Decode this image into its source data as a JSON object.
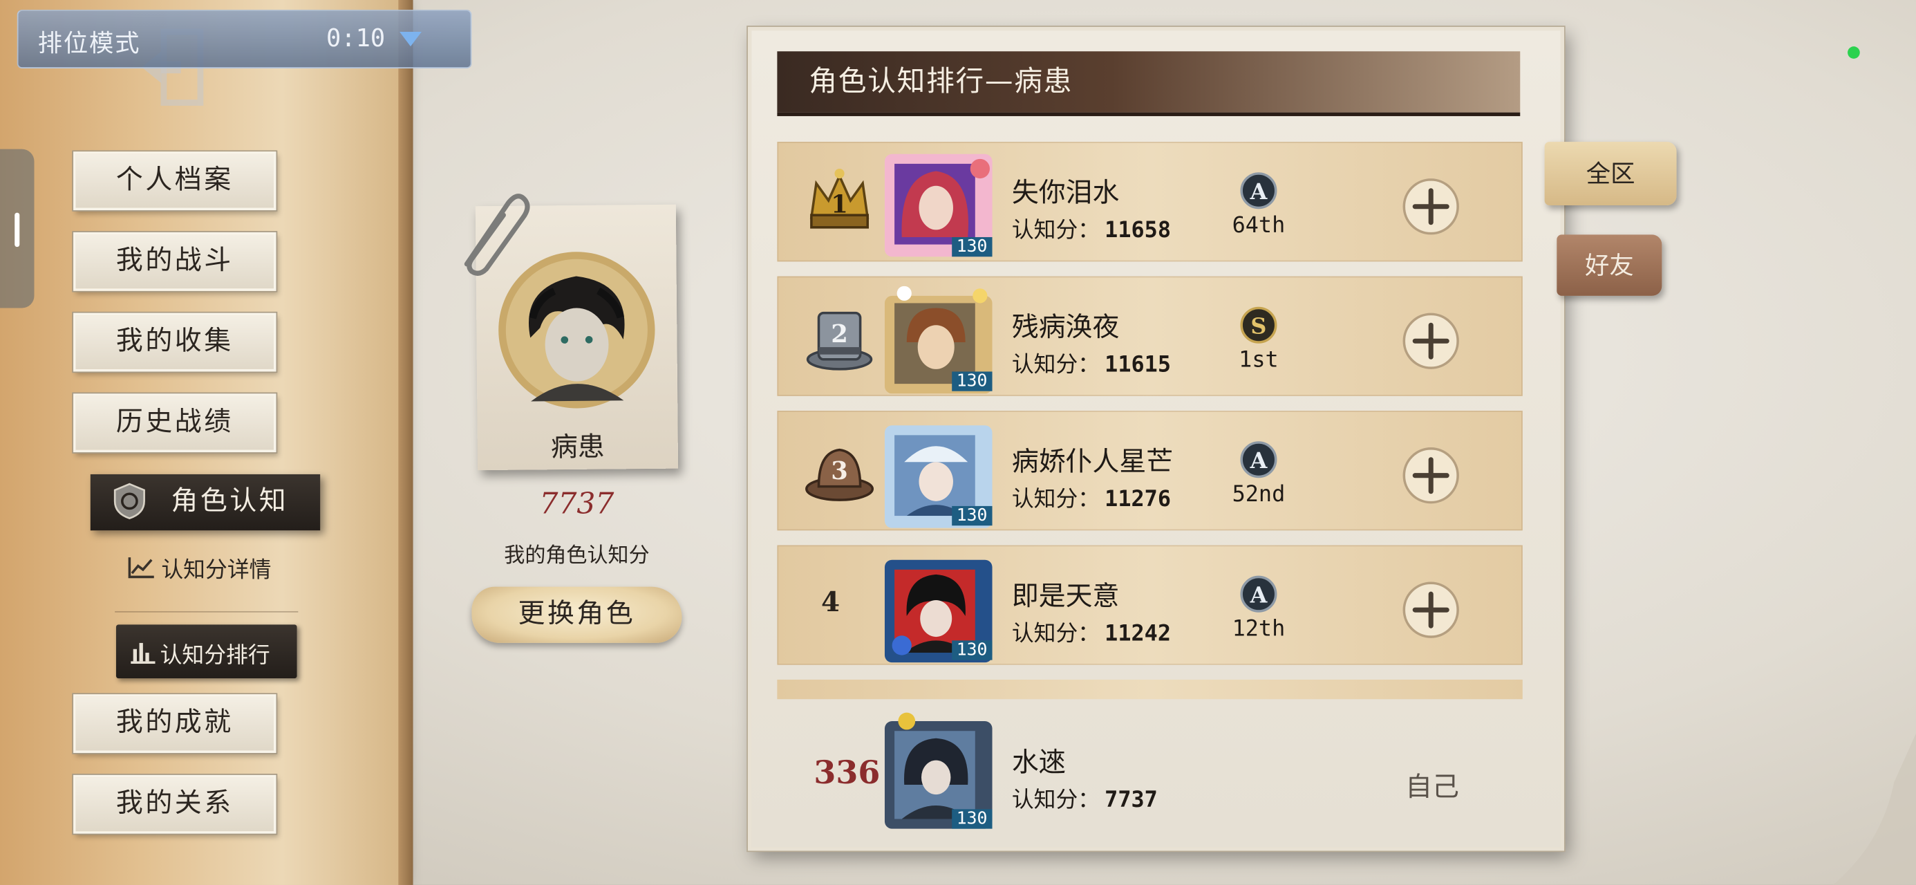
{
  "mode_bar": {
    "title": "排位模式",
    "time": "0:10"
  },
  "sidebar": {
    "items": [
      {
        "label": "个人档案"
      },
      {
        "label": "我的战斗"
      },
      {
        "label": "我的收集"
      },
      {
        "label": "历史战绩"
      },
      {
        "label": "角色认知"
      },
      {
        "label": "我的成就"
      },
      {
        "label": "我的关系"
      }
    ],
    "sub_items": [
      {
        "label": "认知分详情"
      },
      {
        "label": "认知分排行"
      }
    ]
  },
  "character": {
    "name": "病患",
    "score": "7737",
    "score_label": "我的角色认知分",
    "change_button": "更换角色"
  },
  "leaderboard": {
    "title": "角色认知排行—病患",
    "score_prefix": "认知分：",
    "rows": [
      {
        "rank": "1",
        "name": "失你泪水",
        "score": "11658",
        "tier": "A",
        "tier_rank": "64th",
        "level": "130"
      },
      {
        "rank": "2",
        "name": "残病涣夜",
        "score": "11615",
        "tier": "S",
        "tier_rank": "1st",
        "level": "130"
      },
      {
        "rank": "3",
        "name": "病娇仆人星芒",
        "score": "11276",
        "tier": "A",
        "tier_rank": "52nd",
        "level": "130"
      },
      {
        "rank": "4",
        "name": "即是天意",
        "score": "11242",
        "tier": "A",
        "tier_rank": "12th",
        "level": "130"
      }
    ],
    "self": {
      "rank": "336",
      "name": "水逨",
      "score": "7737",
      "level": "130",
      "tag": "自己"
    }
  },
  "tabs": {
    "all": "全区",
    "friends": "好友"
  },
  "colors": {
    "accent_red": "#8b2d2d",
    "title_bar": "#3a2a22",
    "row_bg": "#e8d3ae",
    "status_green": "#2bd24f"
  },
  "icons": {
    "rank1": "crown-icon",
    "rank2": "top-hat-icon",
    "rank3": "fedora-icon",
    "tier_A": "tier-a-badge-icon",
    "tier_S": "tier-s-badge-icon",
    "add": "plus-circle-icon"
  }
}
